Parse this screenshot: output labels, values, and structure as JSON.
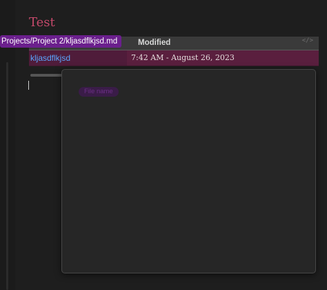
{
  "document": {
    "title": "Test"
  },
  "tooltip": {
    "path": "Projects/Project 2/kljasdflkjsd.md"
  },
  "table": {
    "headers": {
      "name": "",
      "modified": "Modified"
    },
    "header_icon": "code-icon",
    "header_icon_glyph": "</>",
    "rows": [
      {
        "name": "kljasdflkjsd",
        "modified": "7:42 AM - August 26, 2023"
      }
    ]
  },
  "popover": {
    "pill_label": "File name"
  },
  "colors": {
    "background": "#1e1e1e",
    "title": "#c5496b",
    "link": "#5aa6ff",
    "row_highlight": "#5a1f3e",
    "tooltip": "#6b1f8d"
  }
}
